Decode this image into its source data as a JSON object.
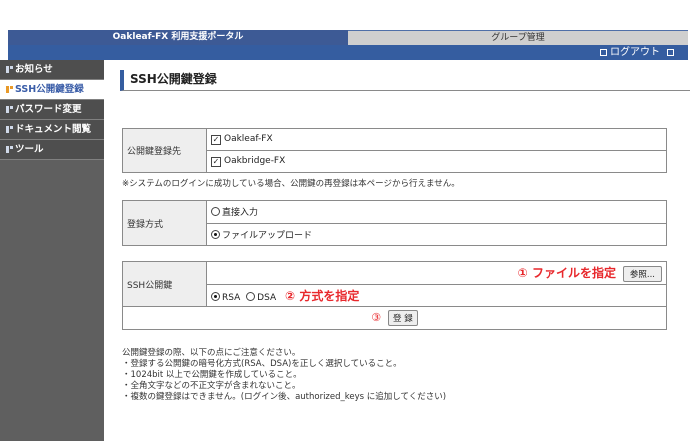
{
  "header": {
    "portal_title": "Oakleaf-FX 利用支援ポータル",
    "group_tab": "グループ管理",
    "logout_label": "ログアウト"
  },
  "sidebar": {
    "items": [
      {
        "label": "お知らせ",
        "active": false
      },
      {
        "label": "SSH公開鍵登録",
        "active": true
      },
      {
        "label": "パスワード変更",
        "active": false
      },
      {
        "label": "ドキュメント閲覧",
        "active": false
      },
      {
        "label": "ツール",
        "active": false
      }
    ]
  },
  "main": {
    "title": "SSH公開鍵登録",
    "register_target": {
      "label": "公開鍵登録先",
      "options": [
        {
          "label": "Oakleaf-FX",
          "checked": true
        },
        {
          "label": "Oakbridge-FX",
          "checked": true
        }
      ],
      "note": "※システムのログインに成功している場合、公開鍵の再登録は本ページから行えません。"
    },
    "register_method": {
      "label": "登録方式",
      "options": [
        {
          "label": "直接入力",
          "selected": false
        },
        {
          "label": "ファイルアップロード",
          "selected": true
        }
      ]
    },
    "ssh_key": {
      "label": "SSH公開鍵",
      "file_annotation": "① ファイルを指定",
      "browse_label": "参照...",
      "types": [
        {
          "label": "RSA",
          "selected": true
        },
        {
          "label": "DSA",
          "selected": false
        }
      ],
      "type_annotation": "② 方式を指定"
    },
    "submit": {
      "annotation": "③",
      "label": "登 録"
    },
    "notes": [
      "公開鍵登録の際、以下の点にご注意ください。",
      "・登録する公開鍵の暗号化方式(RSA、DSA)を正しく選択していること。",
      "・1024bit 以上で公開鍵を作成していること。",
      "・全角文字などの不正文字が含まれないこと。",
      "・複数の鍵登録はできません。(ログイン後、authorized_keys に追加してください)"
    ]
  },
  "colors": {
    "header_blue": "#355da0",
    "sidebar_gray": "#5f5f5f",
    "annotation_red": "#e8282c"
  }
}
